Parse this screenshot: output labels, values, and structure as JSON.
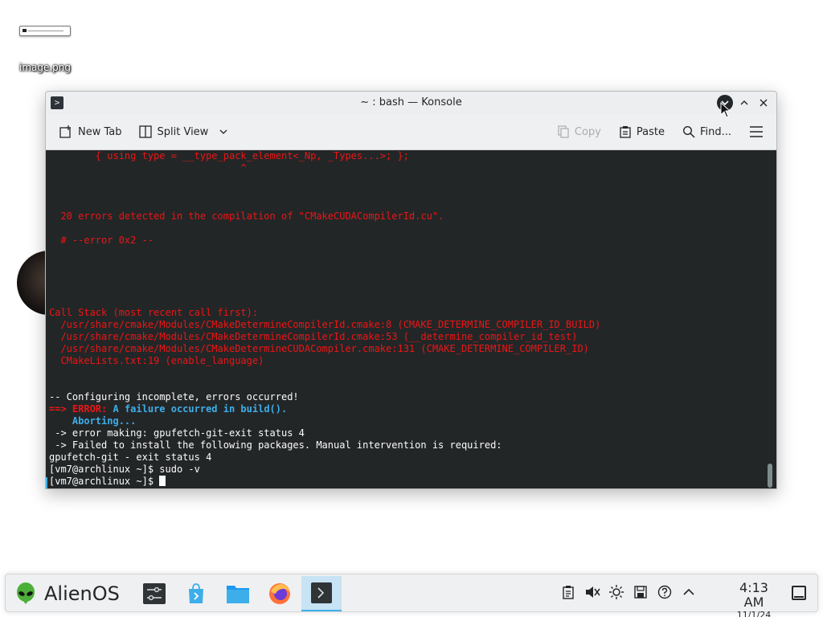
{
  "desktop": {
    "icon_label": "image.png"
  },
  "window": {
    "title": "~ : bash — Konsole"
  },
  "toolbar": {
    "new_tab": "New Tab",
    "split_view": "Split View",
    "copy": "Copy",
    "paste": "Paste",
    "find": "Find..."
  },
  "terminal": {
    "lines": [
      {
        "text": "        { using type = __type_pack_element<_Np, _Types...>; };",
        "style": "red"
      },
      {
        "text": "                                 ^",
        "style": "red"
      },
      {
        "text": "",
        "style": "red"
      },
      {
        "text": "",
        "style": "red"
      },
      {
        "text": "",
        "style": "red"
      },
      {
        "text": "  20 errors detected in the compilation of \"CMakeCUDACompilerId.cu\".",
        "style": "red"
      },
      {
        "text": "",
        "style": "red"
      },
      {
        "text": "  # --error 0x2 --",
        "style": "red"
      },
      {
        "text": "",
        "style": "red"
      },
      {
        "text": "",
        "style": "red"
      },
      {
        "text": "",
        "style": "red"
      },
      {
        "text": "",
        "style": "red"
      },
      {
        "text": "",
        "style": "red"
      },
      {
        "text": "Call Stack (most recent call first):",
        "style": "red"
      },
      {
        "text": "  /usr/share/cmake/Modules/CMakeDetermineCompilerId.cmake:8 (CMAKE_DETERMINE_COMPILER_ID_BUILD)",
        "style": "red"
      },
      {
        "text": "  /usr/share/cmake/Modules/CMakeDetermineCompilerId.cmake:53 (__determine_compiler_id_test)",
        "style": "red"
      },
      {
        "text": "  /usr/share/cmake/Modules/CMakeDetermineCUDACompiler.cmake:131 (CMAKE_DETERMINE_COMPILER_ID)",
        "style": "red"
      },
      {
        "text": "  CMakeLists.txt:19 (enable_language)",
        "style": "red"
      },
      {
        "text": "",
        "style": "normal"
      },
      {
        "text": "",
        "style": "normal"
      },
      {
        "text": "-- Configuring incomplete, errors occurred!",
        "style": "normal"
      },
      {
        "text": "",
        "style": "error"
      },
      {
        "text": "",
        "style": "abort"
      },
      {
        "text": " -> error making: gpufetch-git-exit status 4",
        "style": "normal"
      },
      {
        "text": " -> Failed to install the following packages. Manual intervention is required:",
        "style": "normal"
      },
      {
        "text": "gpufetch-git - exit status 4",
        "style": "normal"
      },
      {
        "text": "[vm7@archlinux ~]$ sudo -v",
        "style": "normal"
      },
      {
        "text": "[vm7@archlinux ~]$ ",
        "style": "prompt"
      }
    ],
    "error_arrow": "==> ",
    "error_label": "ERROR:",
    "error_message": " A failure occurred in build().",
    "aborting": "    Aborting..."
  },
  "taskbar": {
    "launcher_label": "AlienOS",
    "clock_time": "4:13 AM",
    "clock_date": "11/1/24"
  },
  "colors": {
    "terminal_bg": "#232627",
    "error_red": "#ed1515",
    "accent_blue": "#3daee9"
  }
}
